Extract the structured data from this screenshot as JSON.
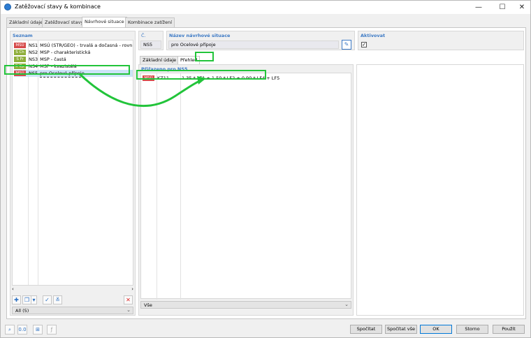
{
  "window": {
    "title": "Zatěžovací stavy & kombinace",
    "minimize": "—",
    "maximize": "☐",
    "close": "✕"
  },
  "tabs": [
    {
      "label": "Základní údaje"
    },
    {
      "label": "Zatěžovací stavy"
    },
    {
      "label": "Návrhové situace"
    },
    {
      "label": "Kombinace zatížení"
    }
  ],
  "left": {
    "section_label": "Seznam",
    "items": [
      {
        "badge": "MSÚ",
        "badge_color": "#d64b4b",
        "code": "NS1",
        "text": "MSÚ (STR/GEO) - trvalá a dočasná - rovn. 6.10"
      },
      {
        "badge": "S Ch",
        "badge_color": "#8fae3a",
        "code": "NS2",
        "text": "MSP - charakteristická"
      },
      {
        "badge": "S Fr",
        "badge_color": "#8fae3a",
        "code": "NS3",
        "text": "MSP - častá"
      },
      {
        "badge": "S Qp",
        "badge_color": "#8fae3a",
        "code": "NS4",
        "text": "MSP - kvazistálá"
      },
      {
        "badge": "MSÚ",
        "badge_color": "#d64b4b",
        "code": "NS5",
        "text": "pro Ocelové přípoje"
      }
    ],
    "filter_value": "All (5)",
    "delete_icon": "✕"
  },
  "header": {
    "number_label": "Č.",
    "number_value": "NS5",
    "name_label": "Název návrhové situace",
    "name_value": "pro Ocelové přípoje",
    "active_label": "Aktivovat",
    "active_checked": "✓"
  },
  "subtabs": [
    {
      "label": "Základní údaje"
    },
    {
      "label": "Přehled"
    }
  ],
  "assigned": {
    "label": "Přiřazeno pro NS5",
    "rows": [
      {
        "badge": "MSÚ",
        "badge_color": "#d64b4b",
        "code": "KZ11",
        "formula": "1.35 * LF1 + 1.50 * LF2 + 0.90 * LF4 + LF5"
      }
    ],
    "filter_value": "Vše"
  },
  "buttons": {
    "calculate": "Spočítat",
    "calculate_all": "Spočítat vše",
    "ok": "OK",
    "cancel": "Storno",
    "apply": "Použít"
  },
  "accent_color": "#22c43a"
}
